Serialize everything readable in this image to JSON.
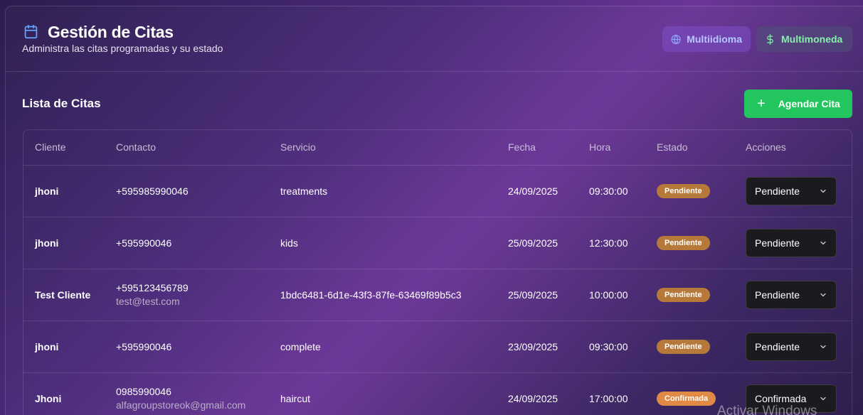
{
  "header": {
    "title": "Gestión de Citas",
    "subtitle": "Administra las citas programadas y su estado",
    "lang_label": "Multiidioma",
    "currency_label": "Multimoneda"
  },
  "list": {
    "title": "Lista de Citas",
    "add_label": "Agendar Cita"
  },
  "table": {
    "columns": [
      "Cliente",
      "Contacto",
      "Servicio",
      "Fecha",
      "Hora",
      "Estado",
      "Acciones"
    ],
    "rows": [
      {
        "cliente": "jhoni",
        "telefono": "+595985990046",
        "email": "",
        "servicio": "treatments",
        "fecha": "24/09/2025",
        "hora": "09:30:00",
        "estado": "Pendiente",
        "accion": "Pendiente"
      },
      {
        "cliente": "jhoni",
        "telefono": "+595990046",
        "email": "",
        "servicio": "kids",
        "fecha": "25/09/2025",
        "hora": "12:30:00",
        "estado": "Pendiente",
        "accion": "Pendiente"
      },
      {
        "cliente": "Test Cliente",
        "telefono": "+595123456789",
        "email": "test@test.com",
        "servicio": "1bdc6481-6d1e-43f3-87fe-63469f89b5c3",
        "fecha": "25/09/2025",
        "hora": "10:00:00",
        "estado": "Pendiente",
        "accion": "Pendiente"
      },
      {
        "cliente": "jhoni",
        "telefono": "+595990046",
        "email": "",
        "servicio": "complete",
        "fecha": "23/09/2025",
        "hora": "09:30:00",
        "estado": "Pendiente",
        "accion": "Pendiente"
      },
      {
        "cliente": "Jhoni",
        "telefono": "0985990046",
        "email": "alfagroupstoreok@gmail.com",
        "servicio": "haircut",
        "fecha": "24/09/2025",
        "hora": "17:00:00",
        "estado": "Confirmada",
        "accion": "Confirmada"
      }
    ]
  },
  "colors": {
    "accent_green": "#22c55e",
    "badge_pendiente": "#b7793a",
    "badge_confirmada": "#e08a45"
  },
  "watermark": "Activar Windows"
}
